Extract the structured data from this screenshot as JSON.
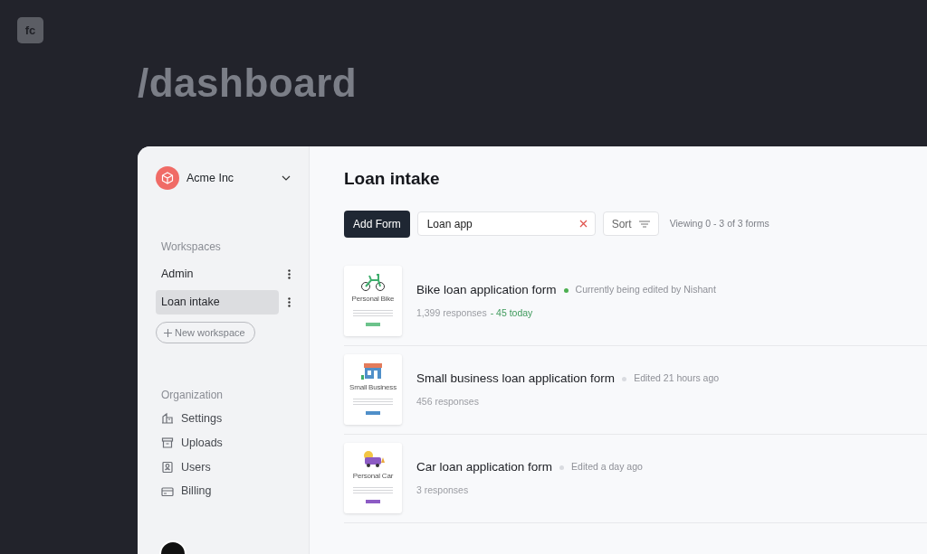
{
  "logo": {
    "text": "fc"
  },
  "heading": "/dashboard",
  "sidebar": {
    "org": {
      "name": "Acme Inc"
    },
    "workspaces_label": "Workspaces",
    "workspaces": [
      {
        "label": "Admin",
        "selected": false
      },
      {
        "label": "Loan intake",
        "selected": true
      }
    ],
    "new_workspace": "New workspace",
    "organization_label": "Organization",
    "organization_items": [
      {
        "label": "Settings",
        "kind": "settings"
      },
      {
        "label": "Uploads",
        "kind": "uploads"
      },
      {
        "label": "Users",
        "kind": "users"
      },
      {
        "label": "Billing",
        "kind": "billing"
      }
    ]
  },
  "main": {
    "title": "Loan intake",
    "add_button": "Add Form",
    "search": {
      "value": "Loan app"
    },
    "sort_button": "Sort",
    "viewing": "Viewing 0 - 3 of 3 forms",
    "forms": [
      {
        "name": "Bike loan application form",
        "status": "Currently being edited by Nishant",
        "color": "#4caf50",
        "responses": "1,399 responses",
        "today": "- 45 today",
        "thumb": {
          "kind": "bike",
          "title": "Personal Bike",
          "color": "#6cc38b"
        }
      },
      {
        "name": "Small business loan application form",
        "status": "Edited 21 hours ago",
        "color": "#d9dbe0",
        "responses": "456 responses",
        "thumb": {
          "kind": "shop",
          "title": "Small Business",
          "color": "#4f8fc9"
        }
      },
      {
        "name": "Car loan application form",
        "status": "Edited a day ago",
        "color": "#d9dbe0",
        "responses": "3 responses",
        "thumb": {
          "kind": "car",
          "title": "Personal Car",
          "color": "#8c5bc4"
        }
      }
    ]
  }
}
